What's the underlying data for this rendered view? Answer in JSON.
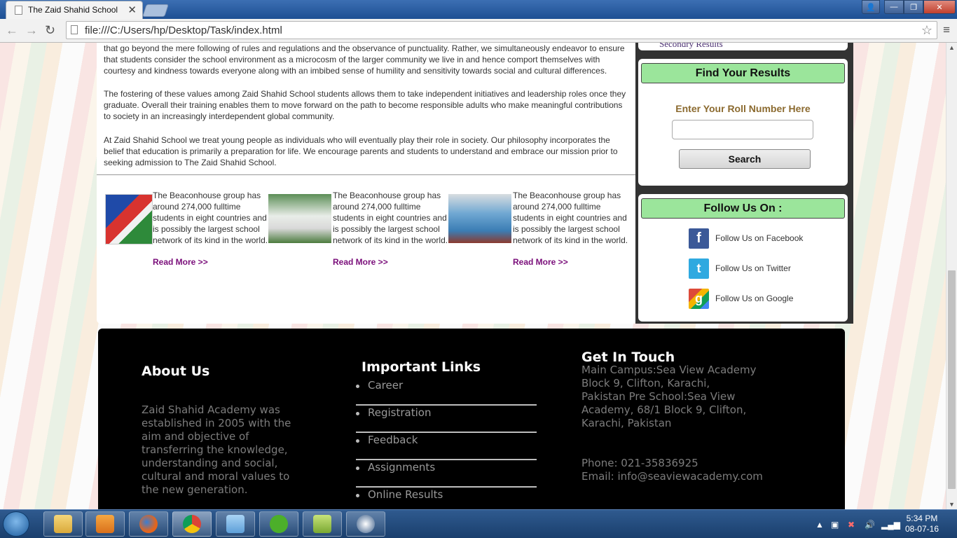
{
  "browser": {
    "tab_title": "The Zaid Shahid School",
    "tab_close": "✕",
    "url": "file:///C:/Users/hp/Desktop/Task/index.html",
    "nav_back": "←",
    "nav_forward": "→",
    "nav_reload": "↻",
    "bookmark_star": "☆",
    "menu": "≡",
    "win_min": "—",
    "win_max": "❐",
    "win_close": "✕"
  },
  "content": {
    "paragraphs": [
      "that go beyond the mere following of rules and regulations and the observance of punctuality. Rather, we simultaneously endeavor to ensure that students consider the school environment as a microcosm of the larger community we live in and hence comport themselves with courtesy and kindness towards everyone along with an imbibed sense of humility and sensitivity towards social and cultural differences.",
      "The fostering of these values among Zaid Shahid School students allows them to take independent initiatives and leadership roles once they graduate. Overall their training enables them to move forward on the path to become responsible adults who make meaningful contributions to society in an increasingly interdependent global community.",
      "At Zaid Shahid School we treat young people as individuals who will eventually play their role in society. Our philosophy incorporates the belief that education is primarily a preparation for life. We encourage parents and students to understand and embrace our mission prior to seeking admission to The Zaid Shahid School."
    ],
    "news": [
      {
        "text": "The Beaconhouse group has around 274,000 fulltime students in eight countries and is possibly the largest school network of its kind in the world.",
        "more": "Read More >>"
      },
      {
        "text": "The Beaconhouse group has around 274,000 fulltime students in eight countries and is possibly the largest school network of its kind in the world.",
        "more": "Read More >>"
      },
      {
        "text": "The Beaconhouse group has around 274,000 fulltime students in eight countries and is possibly the largest school network of its kind in the world.",
        "more": "Read More >>"
      }
    ]
  },
  "sidebar": {
    "secondary_results": "Secondry Results",
    "results_title": "Find Your Results",
    "roll_label": "Enter Your Roll Number Here",
    "roll_value": "",
    "search_label": "Search",
    "follow_title": "Follow Us On :",
    "social": [
      {
        "label": "Follow Us on Facebook",
        "icon": "facebook-icon",
        "color": "#3b5998"
      },
      {
        "label": "Follow Us on Twitter",
        "icon": "twitter-icon",
        "color": "#2fa9e0"
      },
      {
        "label": "Follow Us on Google",
        "icon": "google-icon",
        "color": "#dd4b39"
      }
    ]
  },
  "footer": {
    "about_title": "About Us",
    "about_text": "Zaid Shahid Academy was established in 2005 with the aim and objective of transferring the knowledge, understanding and social, cultural and moral values to the new generation.",
    "links_title": "Important Links",
    "links": [
      "Career",
      "Registration",
      "Feedback",
      "Assignments",
      "Online Results"
    ],
    "contact_title": "Get In Touch",
    "address": "Main Campus:Sea View Academy Block 9, Clifton, Karachi, Pakistan Pre School:Sea View Academy, 68/1 Block 9, Clifton, Karachi, Pakistan",
    "phone": "Phone: 021-35836925",
    "email": "Email: info@seaviewacademy.com"
  },
  "taskbar": {
    "time": "5:34 PM",
    "date": "08-07-16"
  },
  "colors": {
    "accent_green": "#9be59b",
    "link_purple": "#7a0e7a",
    "label_brown": "#8b6a2f"
  }
}
